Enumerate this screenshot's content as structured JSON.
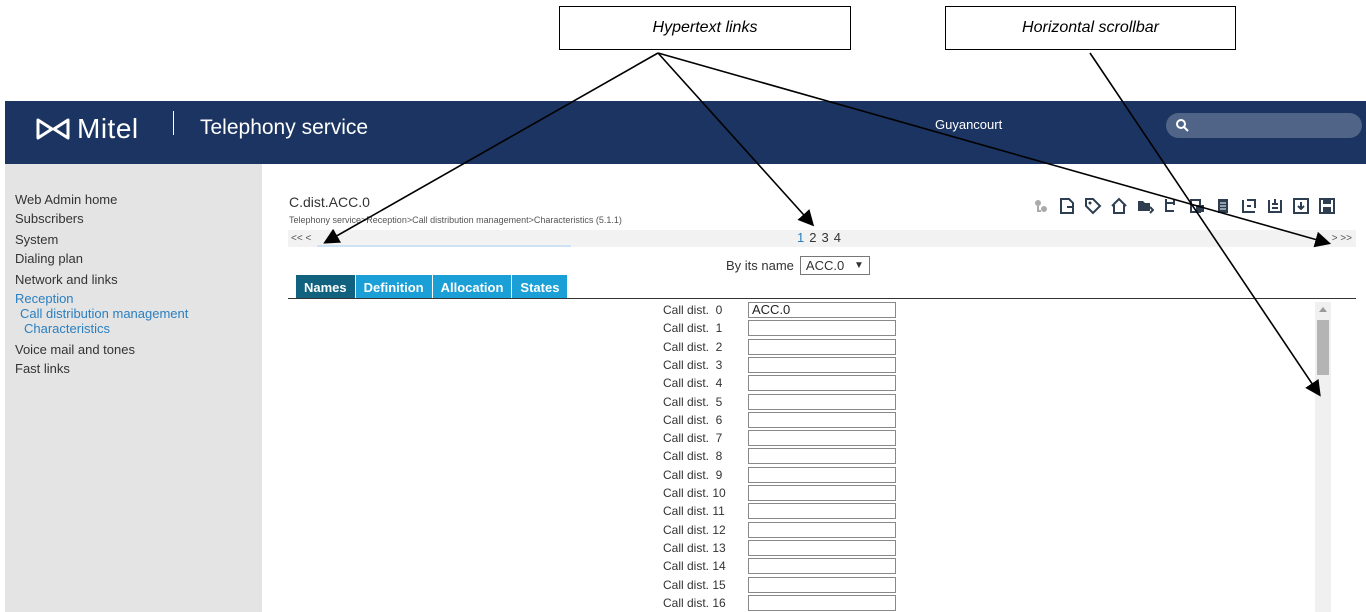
{
  "annotations": {
    "hypertext_links": "Hypertext links",
    "horizontal_scrollbar": "Horizontal scrollbar"
  },
  "header": {
    "brand": "Mitel",
    "app_title": "Telephony service",
    "site": "Guyancourt",
    "search_icon": "search-icon"
  },
  "sidebar": {
    "items": [
      {
        "label": "Web Admin home"
      },
      {
        "label": "Subscribers"
      },
      {
        "label": "System"
      },
      {
        "label": "Dialing plan"
      },
      {
        "label": "Network and links"
      },
      {
        "label": "Reception"
      },
      {
        "label": "Call distribution management"
      },
      {
        "label": "Characteristics"
      },
      {
        "label": "Voice mail and tones"
      },
      {
        "label": "Fast links"
      }
    ]
  },
  "main": {
    "title": "C.dist.ACC.0",
    "breadcrumb": "Telephony service>Reception>Call distribution management>Characteristics (5.1.1)",
    "pager": {
      "prev": "<< <",
      "next": "> >>",
      "pages": [
        "1",
        "2",
        "3",
        "4"
      ],
      "current_page": "1"
    },
    "filter": {
      "label": "By its name",
      "selected": "ACC.0",
      "arrow": "▼"
    },
    "tabs": [
      {
        "label": "Names"
      },
      {
        "label": "Definition"
      },
      {
        "label": "Allocation"
      },
      {
        "label": "States"
      }
    ],
    "rows": [
      {
        "label": "Call dist.  0",
        "value": "ACC.0"
      },
      {
        "label": "Call dist.  1",
        "value": ""
      },
      {
        "label": "Call dist.  2",
        "value": ""
      },
      {
        "label": "Call dist.  3",
        "value": ""
      },
      {
        "label": "Call dist.  4",
        "value": ""
      },
      {
        "label": "Call dist.  5",
        "value": ""
      },
      {
        "label": "Call dist.  6",
        "value": ""
      },
      {
        "label": "Call dist.  7",
        "value": ""
      },
      {
        "label": "Call dist.  8",
        "value": ""
      },
      {
        "label": "Call dist.  9",
        "value": ""
      },
      {
        "label": "Call dist. 10",
        "value": ""
      },
      {
        "label": "Call dist. 11",
        "value": ""
      },
      {
        "label": "Call dist. 12",
        "value": ""
      },
      {
        "label": "Call dist. 13",
        "value": ""
      },
      {
        "label": "Call dist. 14",
        "value": ""
      },
      {
        "label": "Call dist. 15",
        "value": ""
      },
      {
        "label": "Call dist. 16",
        "value": ""
      }
    ]
  },
  "toolbar": {
    "icons": [
      "transfer-icon",
      "document-icon",
      "tag-icon",
      "home-icon",
      "folder-icon",
      "tree-icon",
      "print-icon",
      "list-icon",
      "swap-icon",
      "database-icon",
      "download-icon",
      "save-icon"
    ]
  }
}
